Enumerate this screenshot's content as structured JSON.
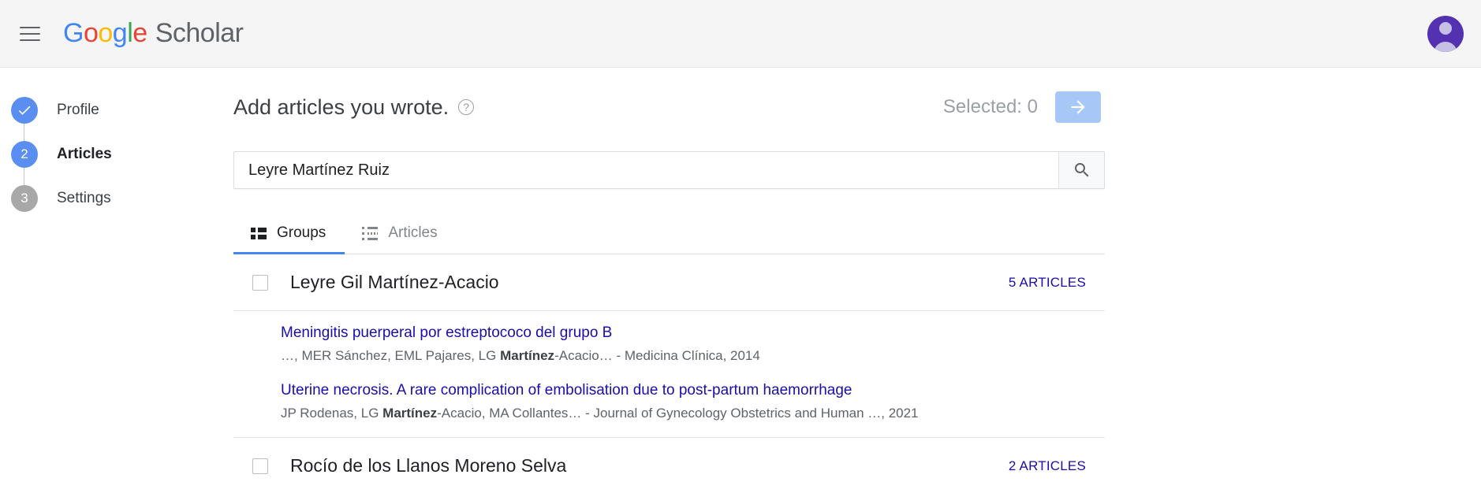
{
  "header": {
    "menu_icon": "hamburger-menu-icon",
    "logo": {
      "google": [
        "G",
        "o",
        "o",
        "g",
        "l",
        "e"
      ],
      "product": "Scholar"
    },
    "avatar_icon": "account-avatar-icon",
    "avatar_color": "#5331b0",
    "background": "#f5f5f5"
  },
  "steps": [
    {
      "id": "profile",
      "marker": "✓",
      "label": "Profile",
      "state": "done",
      "color": "#5a8ef0"
    },
    {
      "id": "articles",
      "marker": "2",
      "label": "Articles",
      "state": "active",
      "color": "#5a8ef0"
    },
    {
      "id": "settings",
      "marker": "3",
      "label": "Settings",
      "state": "todo",
      "color": "#a8a8a8"
    }
  ],
  "main": {
    "title": "Add articles you wrote.",
    "help_icon": "help-question-icon",
    "selected_label": "Selected: 0",
    "next_icon": "arrow-right-icon",
    "next_button_color": "#a7c7f7"
  },
  "search": {
    "value": "Leyre Martínez Ruiz",
    "placeholder": "",
    "button_icon": "search-icon"
  },
  "tabs": [
    {
      "id": "groups",
      "label": "Groups",
      "icon": "groups-list-icon",
      "active": true
    },
    {
      "id": "articles",
      "label": "Articles",
      "icon": "article-list-icon",
      "active": false
    }
  ],
  "results": [
    {
      "name": "Leyre Gil Martínez-Acacio",
      "count_label": "5 ARTICLES",
      "checked": false,
      "articles": [
        {
          "title": "Meningitis puerperal por estreptococo del grupo B",
          "meta_pre": "…, MER Sánchez, EML Pajares, LG ",
          "meta_bold": "Martínez",
          "meta_post": "-Acacio… - Medicina Clínica, 2014"
        },
        {
          "title": "Uterine necrosis. A rare complication of embolisation due to post-partum haemorrhage",
          "meta_pre": "JP Rodenas, LG ",
          "meta_bold": "Martínez",
          "meta_post": "-Acacio, MA Collantes… - Journal of Gynecology Obstetrics and Human …, 2021"
        }
      ]
    },
    {
      "name": "Rocío de los Llanos Moreno Selva",
      "count_label": "2 ARTICLES",
      "checked": false,
      "articles": []
    }
  ],
  "colors": {
    "link": "#1a0dab",
    "accent": "#4285F4",
    "muted": "#9aa0a6",
    "google_blue": "#4285F4",
    "google_red": "#EA4335",
    "google_yellow": "#FBBC05",
    "google_green": "#34A853"
  }
}
